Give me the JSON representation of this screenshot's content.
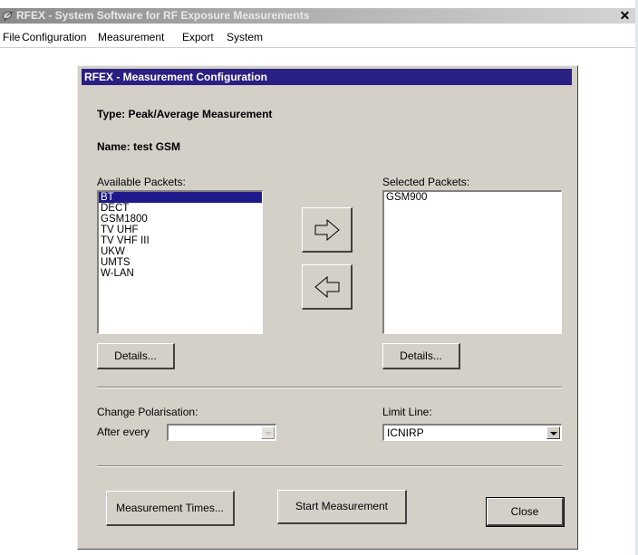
{
  "window": {
    "title": "RFEX - System Software for RF Exposure Measurements",
    "close_symbol": "✕",
    "icon": "satellite-dish-icon"
  },
  "menu": [
    "File",
    "Configuration",
    "Measurement",
    "Export",
    "System"
  ],
  "dialog": {
    "title": "RFEX - Measurement Configuration",
    "type_label": "Type: Peak/Average Measurement",
    "name_label": "Name: test GSM",
    "available_label": "Available Packets:",
    "available_packets": [
      "BT",
      "DECT",
      "GSM1800",
      "TV UHF",
      "TV VHF III",
      "UKW",
      "UMTS",
      "W-LAN"
    ],
    "available_selected_index": 0,
    "selected_label": "Selected Packets:",
    "selected_packets": [
      "GSM900"
    ],
    "details_left": "Details...",
    "details_right": "Details...",
    "add_icon": "arrow-right-icon",
    "remove_icon": "arrow-left-icon",
    "change_polarisation_label": "Change Polarisation:",
    "after_every_label": "After every",
    "after_every_value": "",
    "limit_line_label": "Limit Line:",
    "limit_line_value": "ICNIRP",
    "measurement_times_button": "Measurement Times...",
    "start_measurement_button": "Start Measurement",
    "close_button": "Close"
  },
  "colors": {
    "dialog_title_bg": "#2a1f82",
    "dialog_bg": "#d4d0c8",
    "selection_bg": "#1e1a8c"
  }
}
